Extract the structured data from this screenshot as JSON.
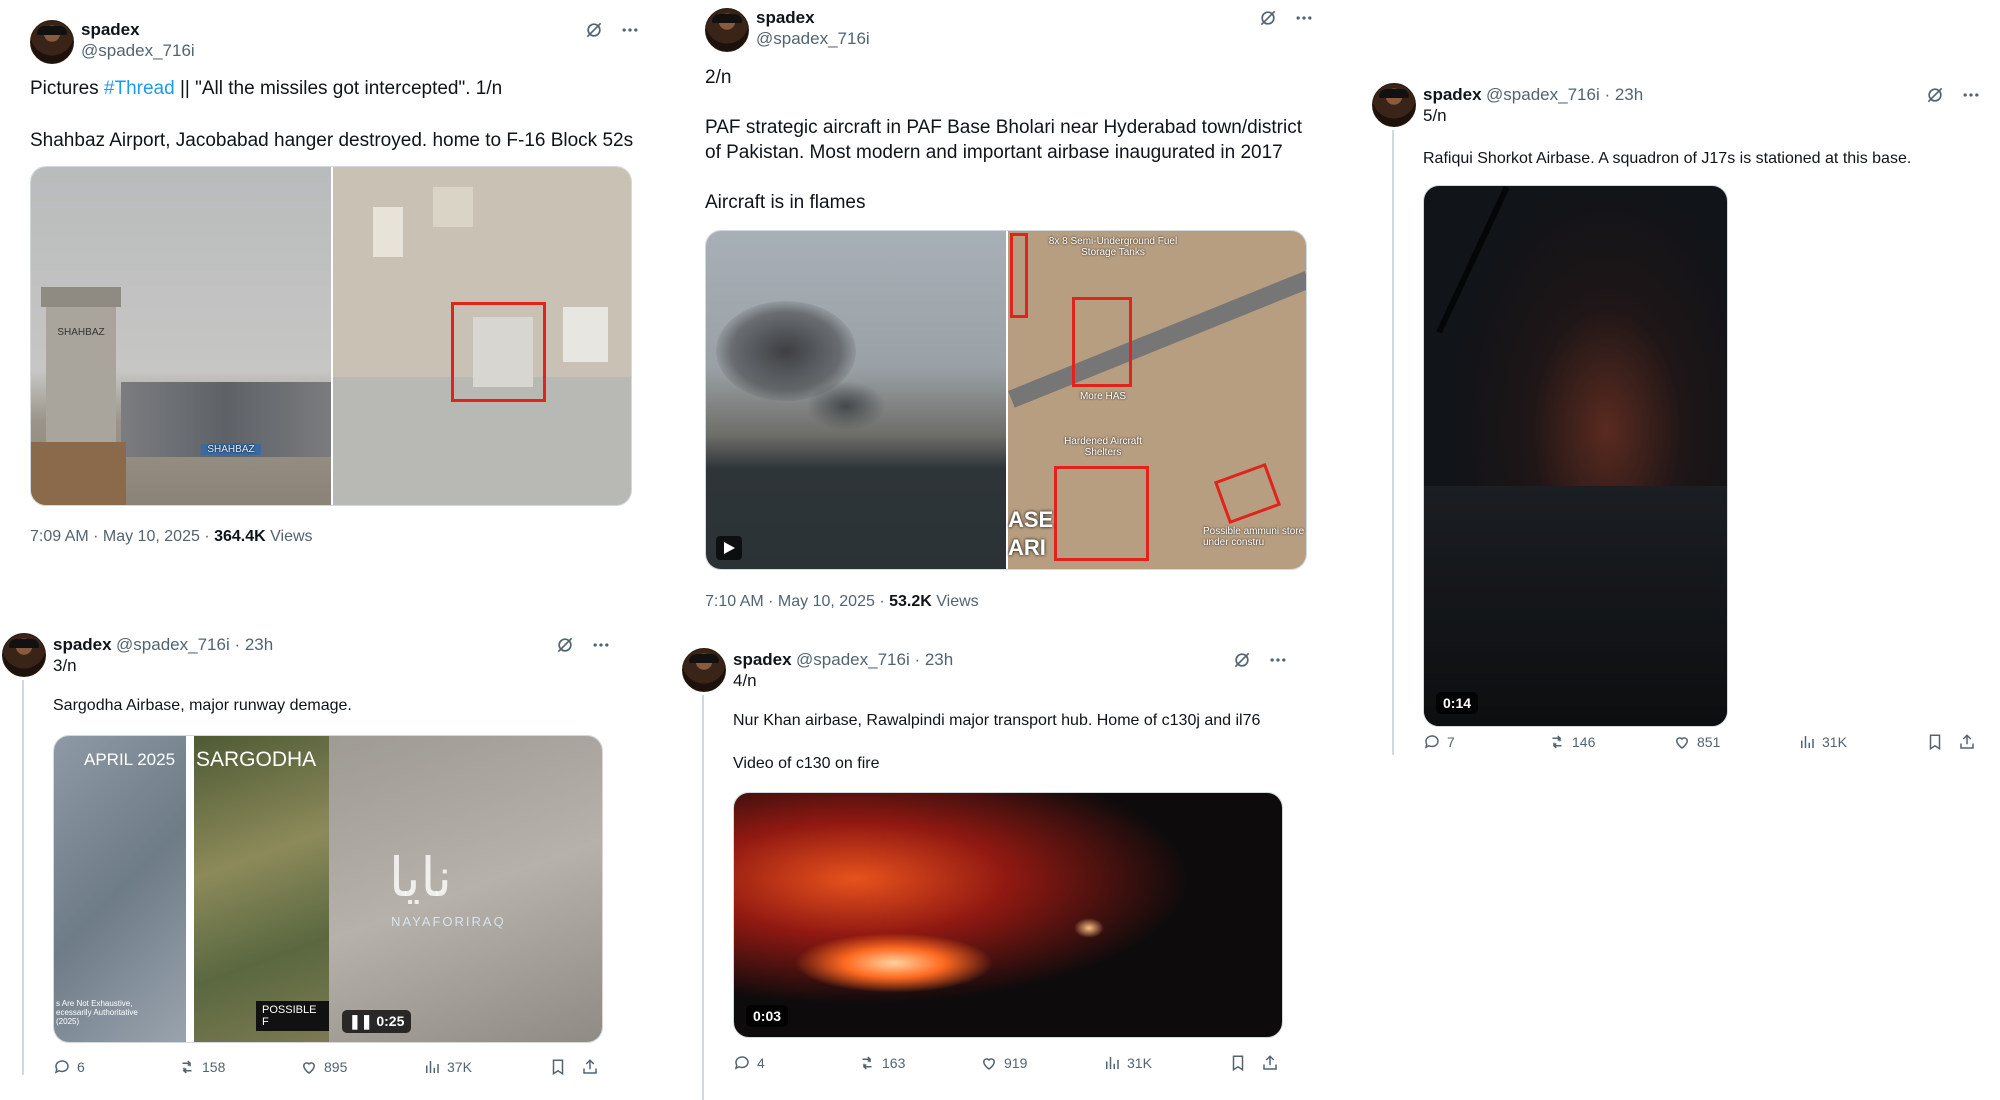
{
  "user": {
    "name": "spadex",
    "handle": "@spadex_716i"
  },
  "tweet1": {
    "text_prefix": "Pictures ",
    "hashtag": "#Thread",
    "text_suffix": " || \"All the missiles got intercepted\". 1/n",
    "body": "Shahbaz Airport, Jacobabad hanger destroyed. home to F-16 Block 52s",
    "sign_top": "SHAHBAZ",
    "sign_bottom": "SHAHBAZ",
    "time": "7:09 AM · May 10, 2025 · ",
    "views_count": "364.4K",
    "views_label": "Views"
  },
  "tweet2": {
    "counter": "2/n",
    "body1": "PAF strategic aircraft in PAF Base Bholari near Hyderabad town/district of Pakistan. Most modern and important airbase inaugurated in 2017",
    "body2": "Aircraft is in flames",
    "label_fuel": "8x 8 Semi-Underground Fuel Storage Tanks",
    "label_has": "More HAS",
    "label_hardened": "Hardened Aircraft Shelters",
    "label_ammo": "Possible ammuni store under constru",
    "label_base": "ASE\nARI",
    "time": "7:10 AM · May 10, 2025 · ",
    "views_count": "53.2K",
    "views_label": "Views"
  },
  "tweet3": {
    "age": " · 23h",
    "counter": "3/n",
    "body": "Sargodha Airbase, major runway demage.",
    "img_april": "APRIL 2025",
    "img_sargodha": "SARGODHA",
    "img_arabic": "نايا",
    "img_watermark": "NAYAFORIRAQ",
    "img_disclaimer": "s Are Not Exhaustive, ecessarily Authoritative (2025)",
    "img_possible": "POSSIBLE F",
    "duration": "0:25",
    "replies": "6",
    "reposts": "158",
    "likes": "895",
    "views": "37K"
  },
  "tweet4": {
    "age": " · 23h",
    "counter": "4/n",
    "body1": "Nur Khan airbase, Rawalpindi major transport hub. Home of c130j and il76",
    "body2": "Video of c130 on fire",
    "duration": "0:03",
    "replies": "4",
    "reposts": "163",
    "likes": "919",
    "views": "31K"
  },
  "tweet5": {
    "age": " · 23h",
    "counter": "5/n",
    "body": "Rafiqui Shorkot Airbase. A squadron of J17s is stationed at this base.",
    "duration": "0:14",
    "replies": "7",
    "reposts": "146",
    "likes": "851",
    "views": "31K"
  }
}
